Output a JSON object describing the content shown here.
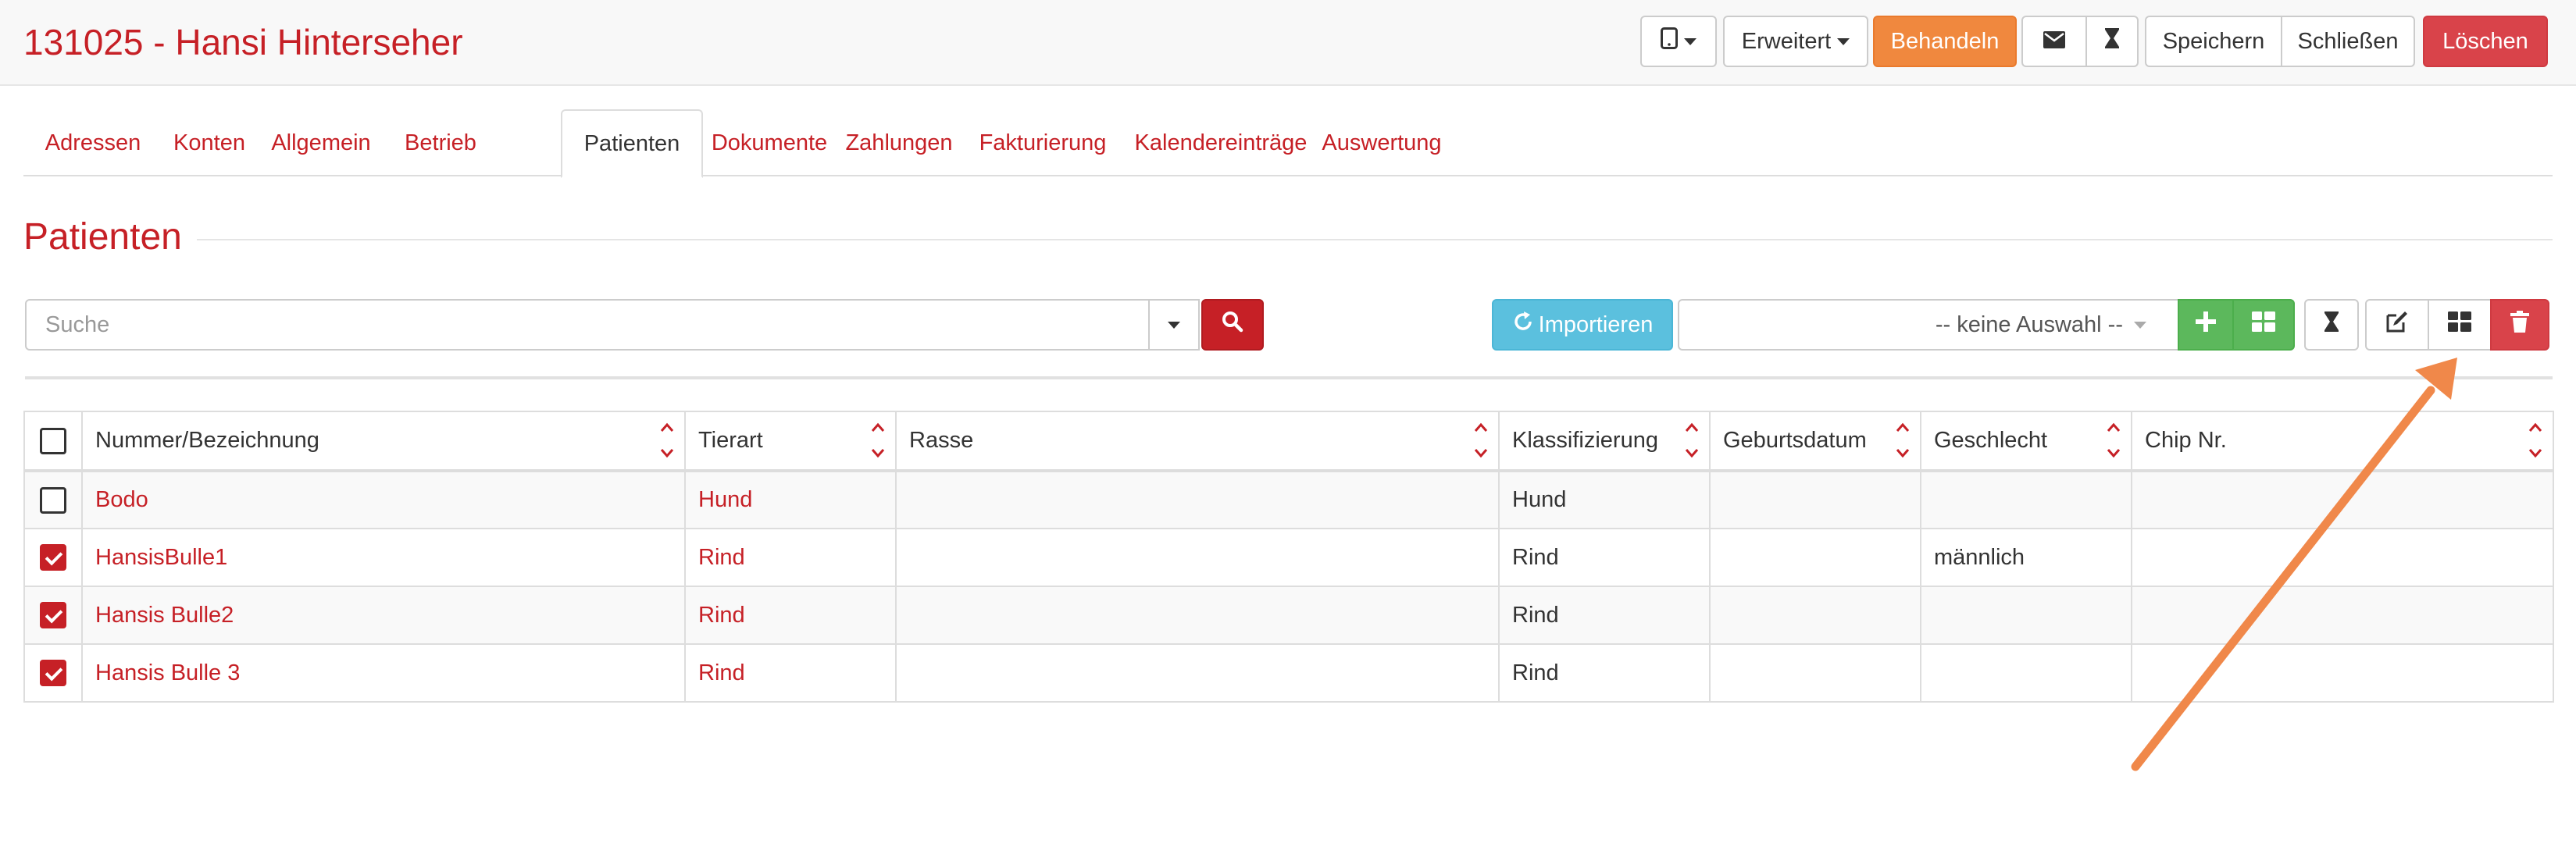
{
  "header": {
    "title": "131025 - Hansi Hinterseher",
    "buttons": {
      "extended": "Erweitert",
      "treat": "Behandeln",
      "save": "Speichern",
      "close": "Schließen",
      "delete": "Löschen"
    }
  },
  "tabs": [
    {
      "label": "Adressen"
    },
    {
      "label": "Konten"
    },
    {
      "label": "Allgemein"
    },
    {
      "label": "Betrieb"
    },
    {
      "label": "Patienten",
      "active": true
    },
    {
      "label": "Dokumente"
    },
    {
      "label": "Zahlungen"
    },
    {
      "label": "Fakturierung"
    },
    {
      "label": "Kalendereinträge"
    },
    {
      "label": "Auswertung"
    }
  ],
  "section": {
    "title": "Patienten"
  },
  "toolbar": {
    "search_placeholder": "Suche",
    "import_label": "Importieren",
    "select_value": "-- keine Auswahl --"
  },
  "table": {
    "columns": [
      "Nummer/Bezeichnung",
      "Tierart",
      "Rasse",
      "Klassifizierung",
      "Geburtsdatum",
      "Geschlecht",
      "Chip Nr."
    ],
    "rows": [
      {
        "checked": false,
        "name": "Bodo",
        "species": "Hund",
        "breed": "",
        "classification": "Hund",
        "birthdate": "",
        "sex": "",
        "chip": ""
      },
      {
        "checked": true,
        "name": "HansisBulle1",
        "species": "Rind",
        "breed": "",
        "classification": "Rind",
        "birthdate": "",
        "sex": "männlich",
        "chip": ""
      },
      {
        "checked": true,
        "name": "Hansis Bulle2",
        "species": "Rind",
        "breed": "",
        "classification": "Rind",
        "birthdate": "",
        "sex": "",
        "chip": ""
      },
      {
        "checked": true,
        "name": "Hansis Bulle 3",
        "species": "Rind",
        "breed": "",
        "classification": "Rind",
        "birthdate": "",
        "sex": "",
        "chip": ""
      }
    ]
  },
  "colors": {
    "brand_red": "#c62026",
    "orange": "#f0883e",
    "danger": "#d9434a",
    "info": "#5bc0de",
    "success": "#5cb85c",
    "annotation_arrow": "#f0884a"
  },
  "icons": [
    "tablet-icon",
    "envelope-icon",
    "hourglass-icon",
    "search-icon",
    "refresh-icon",
    "plus-icon",
    "grid-icon",
    "edit-icon",
    "trash-icon",
    "sort-icon",
    "annotation-arrow"
  ]
}
